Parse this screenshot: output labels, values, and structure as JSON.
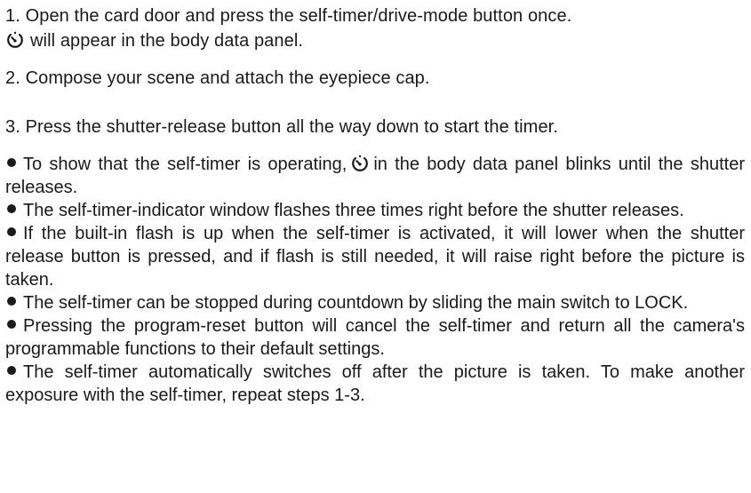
{
  "steps": [
    {
      "number": "1.",
      "line1": "Open the card door and press the self-timer/drive-mode button once.",
      "icon": "self-timer-icon",
      "line2": "will appear in the body data panel."
    },
    {
      "number": "2.",
      "text": "Compose your scene and attach the eyepiece cap."
    },
    {
      "number": "3.",
      "text": "Press the shutter-release button all the way down to start the timer."
    }
  ],
  "bullets": [
    {
      "before_icon": "To show that the self-timer is operating,",
      "icon": "self-timer-icon",
      "after_icon": "in the body data panel blinks until the shutter releases."
    },
    {
      "text": "The self-timer-indicator window flashes three times right before the shutter releases."
    },
    {
      "text": "If the built-in flash is up when the self-timer is activated, it will lower when the shutter release button is pressed, and if flash is still needed, it will raise right before the picture is taken."
    },
    {
      "text": "The self-timer can be stopped during countdown by sliding the main switch to LOCK."
    },
    {
      "text": "Pressing the program-reset button will cancel the self-timer and return all the camera's programmable functions to their default settings."
    },
    {
      "text": "The self-timer automatically switches off after the picture is taken. To make another exposure with the self-timer, repeat steps 1-3."
    }
  ]
}
